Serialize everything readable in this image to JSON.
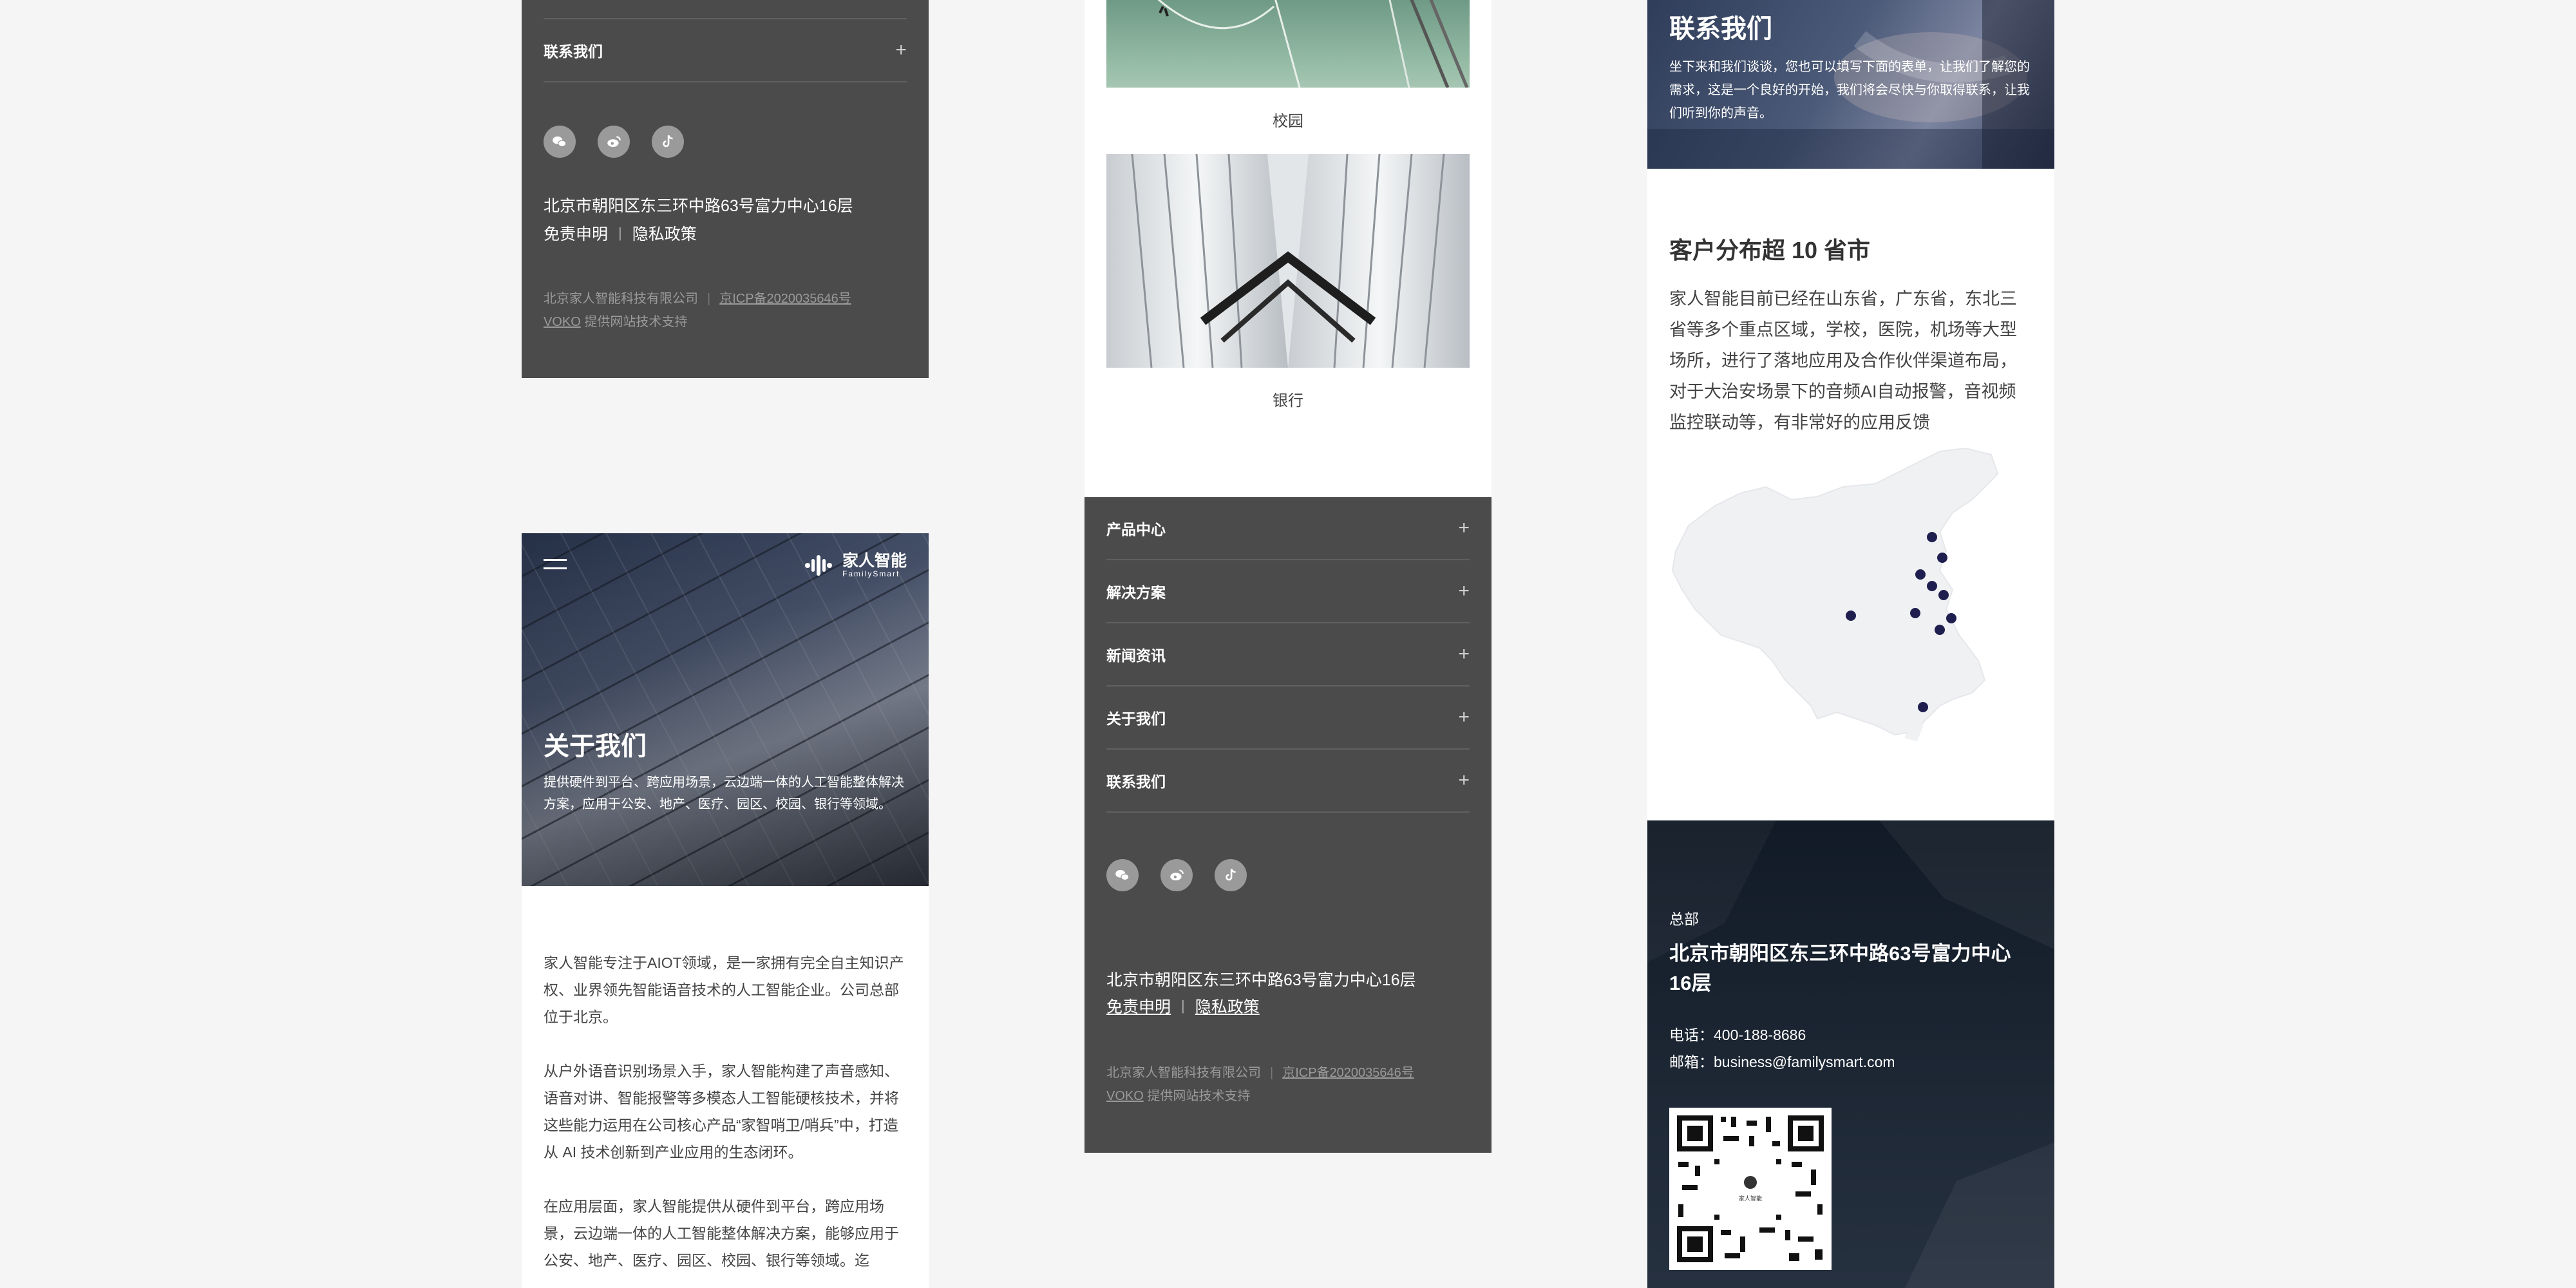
{
  "footer_common": {
    "address": "北京市朝阳区东三环中路63号富力中心16层",
    "disclaimer": "免责申明",
    "privacy": "隐私政策",
    "company": "北京家人智能科技有限公司",
    "icp": "京ICP备2020035646号",
    "voko": "VOKO",
    "support": "提供网站技术支持",
    "social_icons": [
      "wechat-icon",
      "weibo-icon",
      "tiktok-icon"
    ]
  },
  "col1_footer": {
    "last_item": "联系我们"
  },
  "about": {
    "brand_cn": "家人智能",
    "brand_en": "FamilySmart",
    "title": "关于我们",
    "desc": "提供硬件到平台、跨应用场景，云边端一体的人工智能整体解决方案，应用于公安、地产、医疗、园区、校园、银行等领域。",
    "p1": "家人智能专注于AIOT领域，是一家拥有完全自主知识产权、业界领先智能语音技术的人工智能企业。公司总部位于北京。",
    "p2": "从户外语音识别场景入手，家人智能构建了声音感知、语音对讲、智能报警等多模态人工智能硬核技术，并将这些能力运用在公司核心产品“家智哨卫/哨兵”中，打造从 AI 技术创新到产业应用的生态闭环。",
    "p3": "在应用层面，家人智能提供从硬件到平台，跨应用场景，云边端一体的人工智能整体解决方案，能够应用于公安、地产、医疗、园区、校园、银行等领域。迄"
  },
  "cases": {
    "campus_label": "校园",
    "bank_label": "银行"
  },
  "col2_footer": {
    "items": [
      "产品中心",
      "解决方案",
      "新闻资讯",
      "关于我们",
      "联系我们"
    ]
  },
  "contact": {
    "title": "联系我们",
    "desc": "坐下来和我们谈谈，您也可以填写下面的表单，让我们了解您的需求，这是一个良好的开始，我们将会尽快与你取得联系，让我们听到你的声音。",
    "dist_title": "客户分布超 10 省市",
    "dist_desc": "家人智能目前已经在山东省，广东省，东北三省等多个重点区域，学校，医院，机场等大型场所，进行了落地应用及合作伙伴渠道布局，对于大治安场景下的音频AI自动报警，音视频监控联动等，有非常好的应用反馈",
    "hq_label": "总部",
    "hq_address": "北京市朝阳区东三环中路63号富力中心16层",
    "phone": "电话：400-188-8686",
    "email": "邮箱：business@familysmart.com",
    "qr_label": "家人智能"
  },
  "colors": {
    "footer_bg": "#4b4b4b",
    "map_dot": "#1f1f4f",
    "hq_bg": "#17202d"
  }
}
